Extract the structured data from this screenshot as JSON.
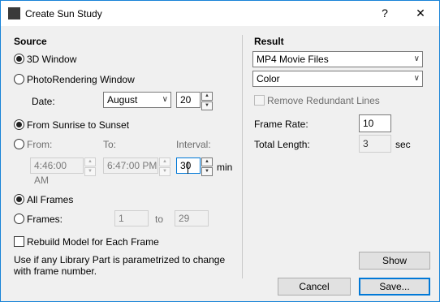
{
  "window": {
    "title": "Create Sun Study",
    "help_label": "?",
    "close_label": "✕"
  },
  "source": {
    "heading": "Source",
    "option_3d": "3D Window",
    "option_photo": "PhotoRendering Window",
    "date_label": "Date:",
    "month": "August",
    "day": "20",
    "option_sunrise": "From Sunrise to Sunset",
    "option_from": "From:",
    "to_label": "To:",
    "interval_label": "Interval:",
    "from_time": "4:46:00 AM",
    "to_time": "6:47:00 PM",
    "interval_value": "30",
    "interval_unit": "min",
    "option_all_frames": "All Frames",
    "option_frames": "Frames:",
    "frames_from": "1",
    "frames_to_label": "to",
    "frames_to": "29",
    "rebuild_label": "Rebuild Model for Each Frame",
    "note": "Use if any Library Part is parametrized to change with frame number."
  },
  "result": {
    "heading": "Result",
    "format": "MP4 Movie Files",
    "color_mode": "Color",
    "remove_lines_label": "Remove Redundant Lines",
    "frame_rate_label": "Frame Rate:",
    "frame_rate": "10",
    "total_length_label": "Total Length:",
    "total_length": "3",
    "total_length_unit": "sec"
  },
  "buttons": {
    "show": "Show",
    "cancel": "Cancel",
    "save": "Save..."
  }
}
